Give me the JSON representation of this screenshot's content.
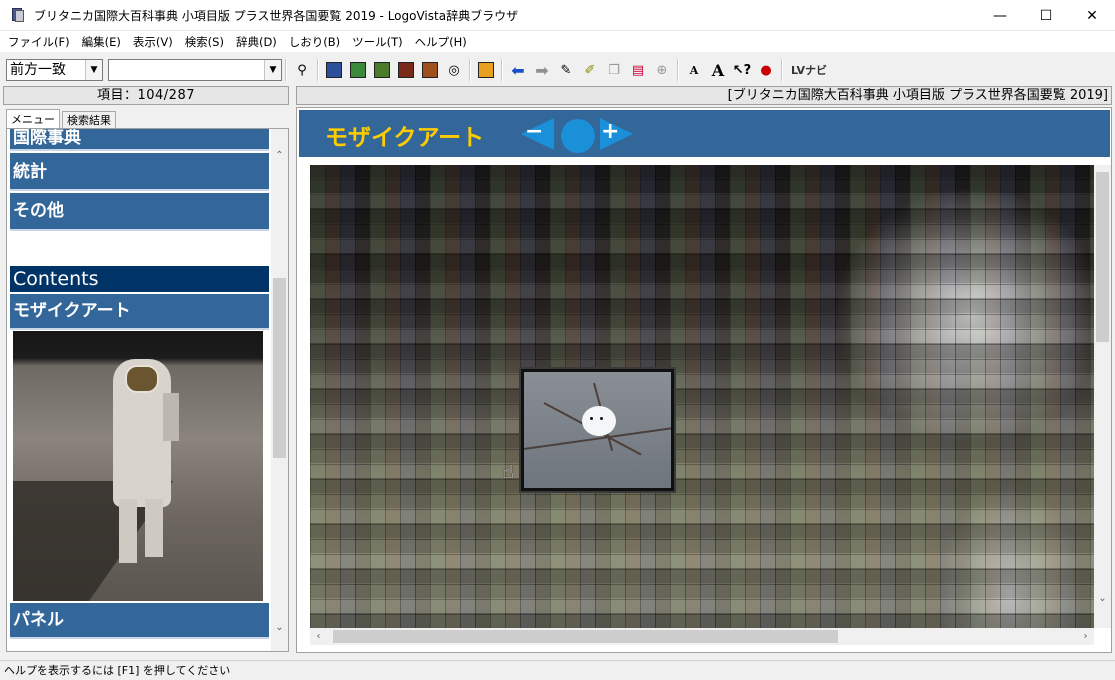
{
  "window": {
    "title": "ブリタニカ国際大百科事典 小項目版 プラス世界各国要覧 2019 - LogoVista辞典ブラウザ",
    "minimize": "—",
    "maximize": "☐",
    "close": "✕"
  },
  "menu": [
    "ファイル(F)",
    "編集(E)",
    "表示(V)",
    "検索(S)",
    "辞典(D)",
    "しおり(B)",
    "ツール(T)",
    "ヘルプ(H)"
  ],
  "toolbar": {
    "search_mode": "前方一致",
    "search_value": "",
    "lv_navi": "LVナビ"
  },
  "left": {
    "item_count": "項目：104/287",
    "tabs": [
      "メニュー",
      "検索結果"
    ],
    "items": [
      {
        "label": "国際事典"
      },
      {
        "label": "統計"
      },
      {
        "label": "その他"
      }
    ],
    "contents_header": "Contents",
    "mosaic_item": "モザイクアート",
    "panel_item": "パネル"
  },
  "right": {
    "dict_name": "[ブリタニカ国際大百科事典 小項目版 プラス世界各国要覧 2019]",
    "banner_title": "モザイクアート"
  },
  "status": {
    "text": "ヘルプを表示するには [F1] を押してください"
  }
}
